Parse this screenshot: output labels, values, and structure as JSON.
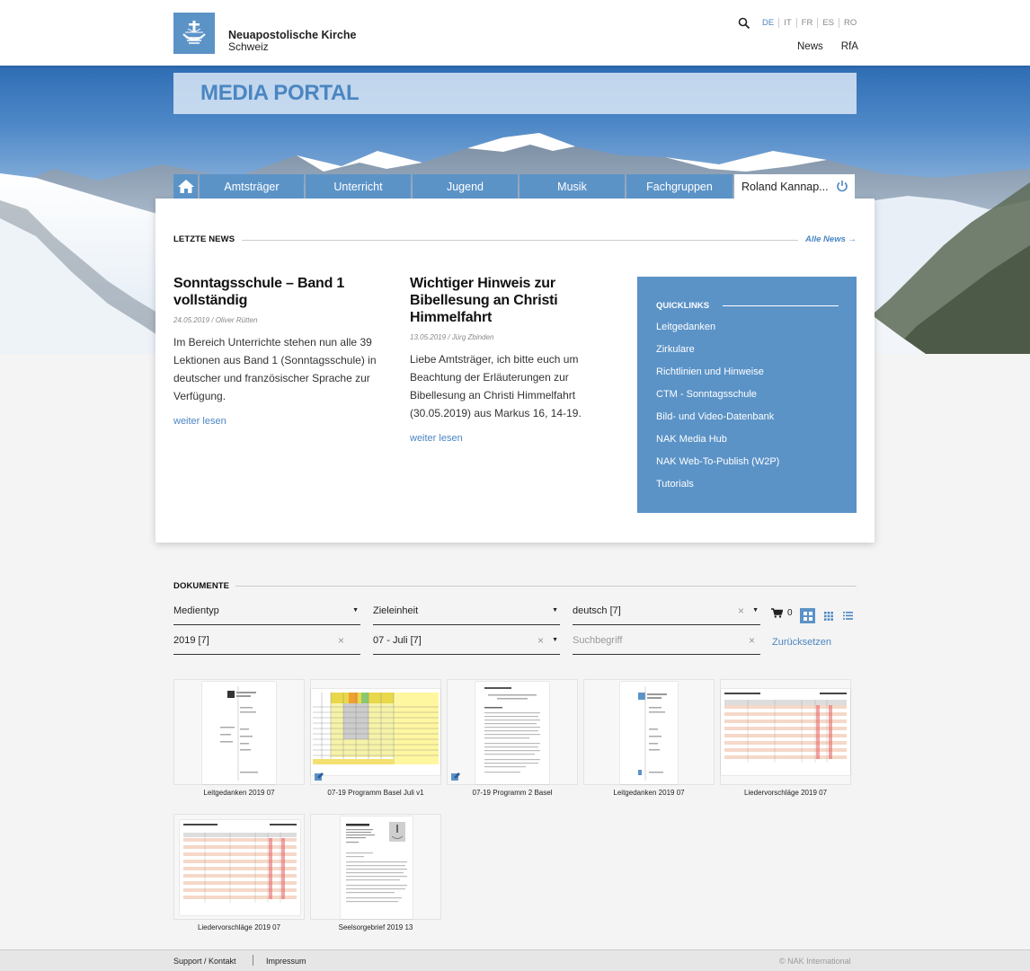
{
  "brand": {
    "name": "Neuapostolische Kirche",
    "region": "Schweiz"
  },
  "languages": [
    "DE",
    "IT",
    "FR",
    "ES",
    "RO"
  ],
  "topnav": [
    "News",
    "RfA"
  ],
  "portal_title": "MEDIA PORTAL",
  "tabs": [
    "Amtsträger",
    "Unterricht",
    "Jugend",
    "Musik",
    "Fachgruppen"
  ],
  "user_tab": "Roland Kannap...",
  "news_section": {
    "heading": "LETZTE NEWS",
    "all_link": "Alle News →"
  },
  "news": [
    {
      "title": "Sonntagsschule – Band 1 vollständig",
      "meta": "24.05.2019 / Oliver Rütten",
      "text": "Im Bereich Unterrichte stehen nun alle 39 Lektionen aus Band 1 (Sonntagsschule) in deutscher und französischer Sprache zur Verfügung.",
      "more": "weiter lesen"
    },
    {
      "title": "Wichtiger Hinweis zur Bibellesung an Christi Himmelfahrt",
      "meta": "13.05.2019 / Jürg Zbinden",
      "text": "Liebe Amtsträger, ich bitte euch um Beachtung der Erläuterungen zur Bibellesung an Christi Himmelfahrt (30.05.2019) aus Markus 16, 14-19.",
      "more": "weiter lesen"
    }
  ],
  "quicklinks": {
    "heading": "QUICKLINKS",
    "items": [
      "Leitgedanken",
      "Zirkulare",
      "Richtlinien und Hinweise",
      "CTM - Sonntagsschule",
      "Bild- und Video-Datenbank",
      "NAK Media Hub",
      "NAK Web-To-Publish (W2P)",
      "Tutorials"
    ]
  },
  "documents": {
    "heading": "DOKUMENTE",
    "filters": {
      "medientyp": "Medientyp",
      "zieleinheit": "Zieleinheit",
      "sprache": "deutsch [7]",
      "jahr": "2019 [7]",
      "monat": "07 - Juli [7]",
      "search_placeholder": "Suchbegriff"
    },
    "reset": "Zurücksetzen",
    "cart_count": "0",
    "items": [
      "Leitgedanken 2019 07",
      "07-19 Programm Basel Juli v1",
      "07-19 Programm 2 Basel",
      "Leitgedanken 2019 07",
      "Liedervorschläge 2019 07",
      "Liedervorschläge 2019 07",
      "Seelsorgebrief 2019 13"
    ]
  },
  "footer": {
    "support": "Support / Kontakt",
    "impressum": "Impressum",
    "copyright": "© NAK International"
  },
  "colors": {
    "accent": "#5b93c7",
    "link": "#4a86c2"
  }
}
